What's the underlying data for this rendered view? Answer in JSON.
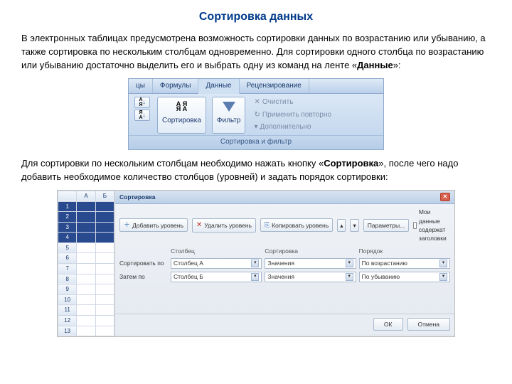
{
  "title": "Сортировка данных",
  "para1": "В электронных таблицах предусмотрена возможность сортировки данных по возрастанию или убыванию, а также сортировка по нескольким столбцам одновременно. Для сортировки одного столбца по возрастанию или убыванию достаточно выделить его и выбрать одну из команд на ленте «",
  "para1_bold": "Данные",
  "para1_tail": "»:",
  "para2_a": "Для сортировки по нескольким столбцам необходимо нажать кнопку «",
  "para2_bold": "Сортировка",
  "para2_b": "», после чего надо добавить необходимое количество столбцов (уровней) и задать порядок сортировки:",
  "ribbon": {
    "tabs": [
      "цы",
      "Формулы",
      "Данные",
      "Рецензирование"
    ],
    "sort_btn": "Сортировка",
    "filter_btn": "Фильтр",
    "clear": "Очистить",
    "reapply": "Применить повторно",
    "advanced": "Дополнительно",
    "group": "Сортировка и фильтр"
  },
  "sheet": {
    "cols": [
      "",
      "А",
      "Б"
    ],
    "rows": [
      "1",
      "2",
      "3",
      "4",
      "5",
      "6",
      "7",
      "8",
      "9",
      "10",
      "11",
      "12",
      "13"
    ]
  },
  "dialog": {
    "title": "Сортировка",
    "add": "Добавить уровень",
    "del": "Удалить уровень",
    "copy": "Копировать уровень",
    "params": "Параметры...",
    "chk": "Мои данные содержат заголовки",
    "h1": "Столбец",
    "h2": "Сортировка",
    "h3": "Порядок",
    "r1_label": "Сортировать по",
    "r1_col": "Столбец А",
    "r1_sort": "Значения",
    "r1_order": "По возрастанию",
    "r2_label": "Затем по",
    "r2_col": "Столбец Б",
    "r2_sort": "Значения",
    "r2_order": "По убыванию",
    "ok": "ОК",
    "cancel": "Отмена"
  }
}
